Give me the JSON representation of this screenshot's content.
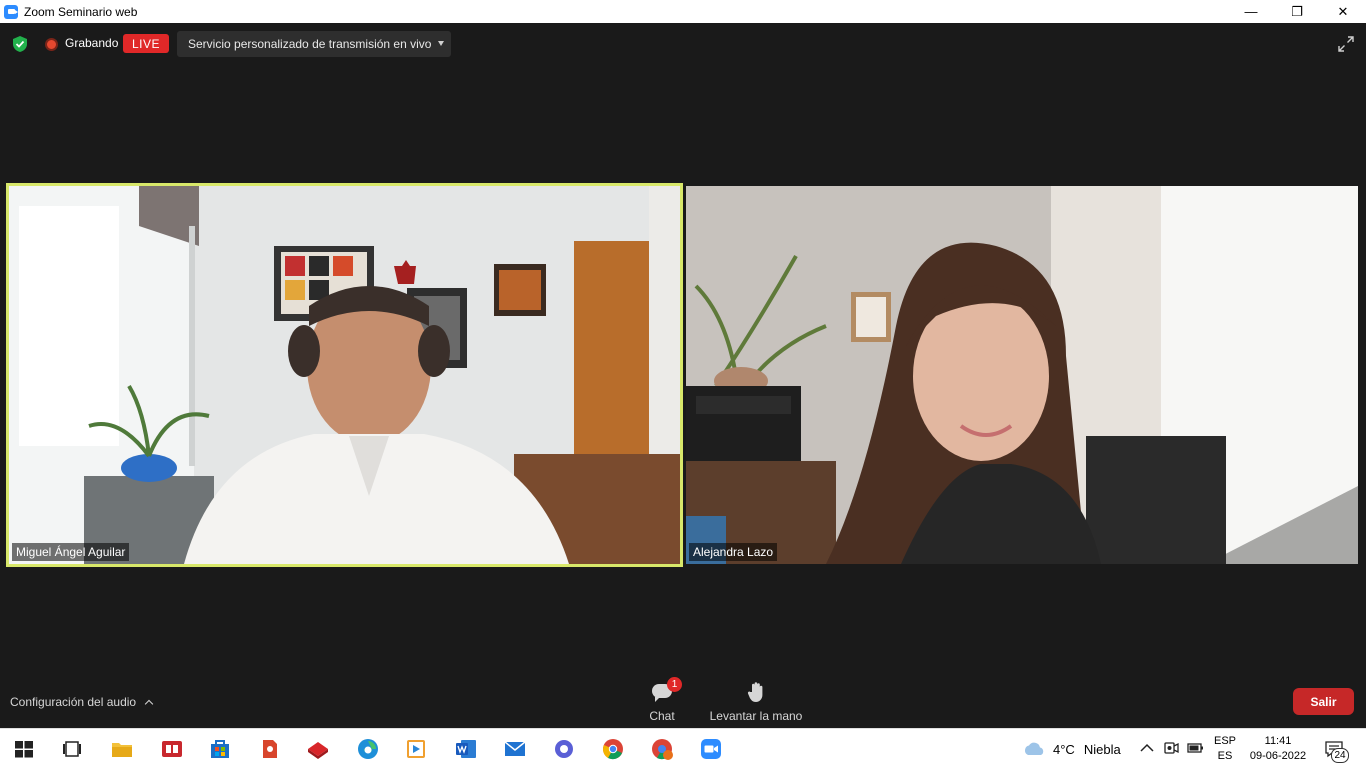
{
  "window": {
    "title": "Zoom Seminario web",
    "minimize_glyph": "—",
    "maximize_glyph": "❐",
    "close_glyph": "✕"
  },
  "topbar": {
    "recording_label": "Grabando",
    "live_label": "LIVE",
    "stream_dropdown_label": "Servicio personalizado de transmisión en vivo"
  },
  "participants": [
    {
      "name": "Miguel Ángel Aguilar",
      "active_speaker": true
    },
    {
      "name": "Alejandra Lazo",
      "active_speaker": false
    }
  ],
  "controls": {
    "audio_settings_label": "Configuración del audio",
    "chat_label": "Chat",
    "chat_badge": "1",
    "raise_hand_label": "Levantar la mano",
    "leave_label": "Salir"
  },
  "taskbar": {
    "apps": [
      "start-icon",
      "task-view-icon",
      "file-explorer-icon",
      "reader-icon",
      "store-icon",
      "app-icon",
      "app-red-icon",
      "edge-icon",
      "media-icon",
      "word-icon",
      "mail-icon",
      "settings-app-icon",
      "chrome-icon",
      "chrome-profile-icon",
      "zoom-icon"
    ],
    "weather_temp": "4°C",
    "weather_desc": "Niebla",
    "lang_top": "ESP",
    "lang_bottom": "ES",
    "time": "11:41",
    "date": "09-06-2022",
    "notifications": "24"
  },
  "colors": {
    "active_speaker_border": "#d8e86a",
    "live_red": "#e02828",
    "leave_red": "#c62828",
    "zoom_blue": "#2d8cff",
    "background": "#1a1a1a"
  }
}
